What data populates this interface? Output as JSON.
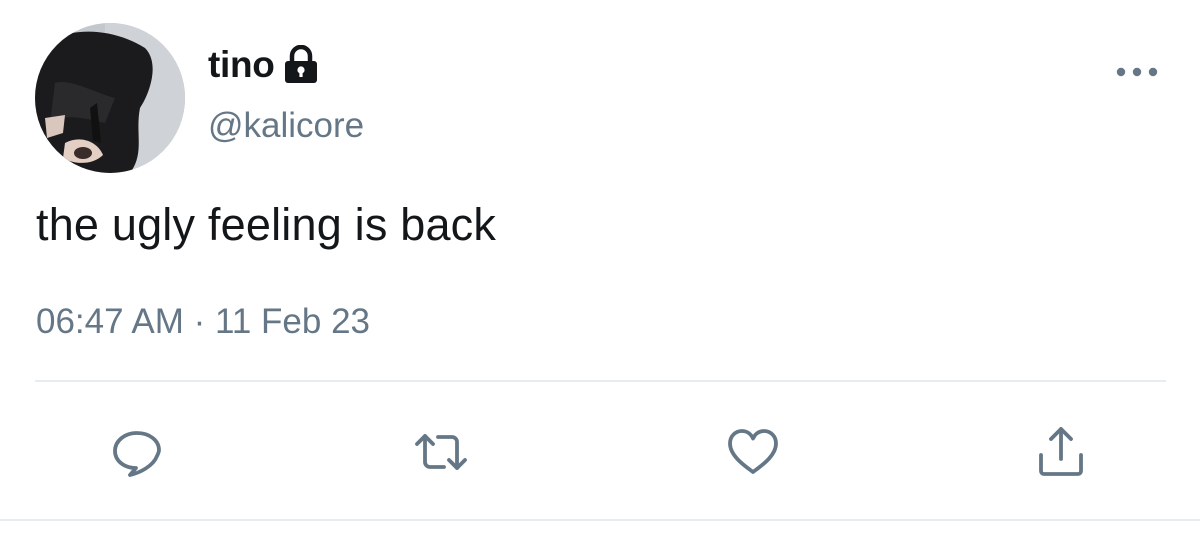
{
  "tweet": {
    "display_name": "tino",
    "handle": "@kalicore",
    "protected_icon": "lock-icon",
    "text": "the ugly feeling is back",
    "timestamp": "06:47 AM · 11 Feb 23",
    "more_icon": "more-options-icon"
  },
  "actions": {
    "reply_icon": "reply-icon",
    "retweet_icon": "retweet-icon",
    "like_icon": "heart-icon",
    "share_icon": "share-icon"
  },
  "colors": {
    "primary_text": "#14171a",
    "secondary_text": "#657786",
    "divider": "#e6ecf0",
    "icon": "#657786"
  }
}
